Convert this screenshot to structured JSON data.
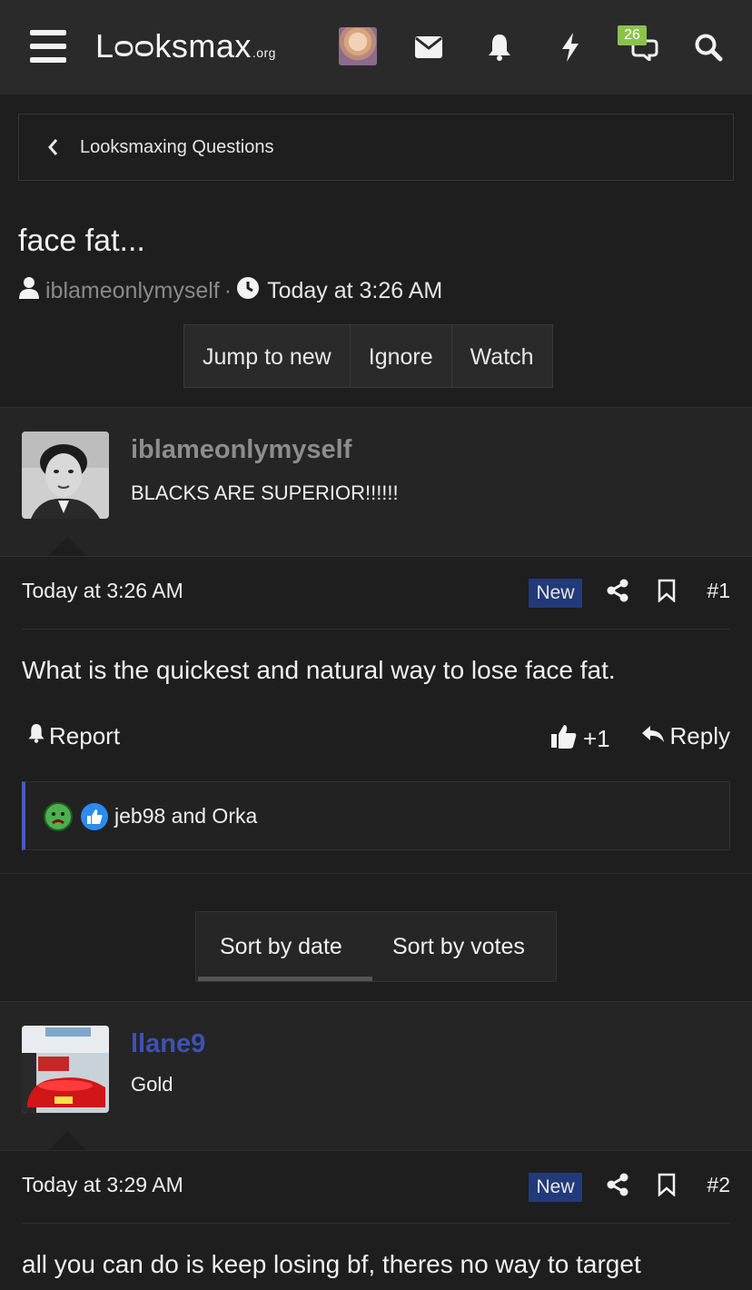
{
  "header": {
    "logo_main": "Lᴑᴑksmax",
    "logo_suffix": ".org",
    "notification_count": "26",
    "icons": [
      "menu-icon",
      "user-avatar",
      "envelope-icon",
      "bell-icon",
      "bolt-icon",
      "chat-icon",
      "search-icon"
    ]
  },
  "breadcrumb": {
    "label": "Looksmaxing Questions"
  },
  "thread": {
    "title": "face fat...",
    "author": "iblameonlymyself",
    "separator": "·",
    "time": "Today at 3:26 AM",
    "buttons": {
      "jump": "Jump to new",
      "ignore": "Ignore",
      "watch": "Watch"
    }
  },
  "posts": [
    {
      "username": "iblameonlymyself",
      "user_title": "BLACKS ARE SUPERIOR!!!!!!",
      "date": "Today at 3:26 AM",
      "badge": "New",
      "number": "#1",
      "body": "What is the quickest and natural way to lose face fat.",
      "report_label": "Report",
      "like_count": "+1",
      "reply_label": "Reply",
      "reactions_text": "jeb98 and Orka"
    },
    {
      "username": "llane9",
      "user_title": "Gold",
      "date": "Today at 3:29 AM",
      "badge": "New",
      "number": "#2",
      "body": "all you can do is keep losing bf, theres no way to target"
    }
  ],
  "sort": {
    "by_date": "Sort by date",
    "by_votes": "Sort by votes"
  },
  "colors": {
    "accent_blue": "#223a7a",
    "username_blue": "#3f51b5",
    "badge_green": "#8bc34a",
    "reaction_border": "#4a58c4"
  }
}
